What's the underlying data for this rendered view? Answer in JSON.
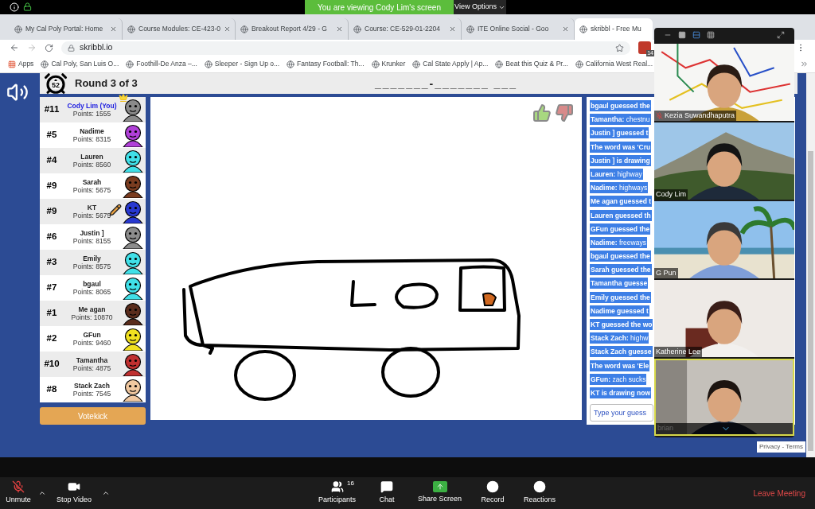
{
  "share_bar": {
    "message": "You are viewing Cody Lim's screen",
    "options": "View Options"
  },
  "tabs": [
    {
      "title": "My Cal Poly Portal: Home",
      "selected": false
    },
    {
      "title": "Course Modules: CE-423-0",
      "selected": false
    },
    {
      "title": "Breakout Report 4/29 - G",
      "selected": false
    },
    {
      "title": "Course: CE-529-01-2204",
      "selected": false
    },
    {
      "title": "ITE Online Social - Goo",
      "selected": false
    },
    {
      "title": "skribbl - Free Mu",
      "selected": true
    }
  ],
  "address": {
    "url": "skribbl.io",
    "extension_badge": "14"
  },
  "bookmarks": [
    "Apps",
    "Cal Poly, San Luis O...",
    "Foothill-De Anza –...",
    "Sleeper - Sign Up o...",
    "Fantasy Football: Th...",
    "Krunker",
    "Cal State Apply | Ap...",
    "Beat this Quiz & Pr...",
    "California West Real..."
  ],
  "game": {
    "timer": "52",
    "round": "Round 3 of 3",
    "hint": "_______-_______ ___",
    "players": [
      {
        "rank": "#11",
        "name": "Cody Lim (You)",
        "points": "Points: 1555",
        "you": true,
        "owner": true,
        "drawing": false,
        "color": "#8a8a8a"
      },
      {
        "rank": "#5",
        "name": "Nadime",
        "points": "Points: 8315",
        "you": false,
        "owner": false,
        "drawing": false,
        "color": "#b040d8"
      },
      {
        "rank": "#4",
        "name": "Lauren",
        "points": "Points: 8560",
        "you": false,
        "owner": false,
        "drawing": false,
        "color": "#40e0e8"
      },
      {
        "rank": "#9",
        "name": "Sarah",
        "points": "Points: 5675",
        "you": false,
        "owner": false,
        "drawing": false,
        "color": "#7a3c20"
      },
      {
        "rank": "#9",
        "name": "KT",
        "points": "Points: 5675",
        "you": false,
        "owner": false,
        "drawing": true,
        "color": "#2838d0"
      },
      {
        "rank": "#6",
        "name": "Justin ]",
        "points": "Points: 8155",
        "you": false,
        "owner": false,
        "drawing": false,
        "color": "#8c8c8c"
      },
      {
        "rank": "#3",
        "name": "Emily",
        "points": "Points: 8575",
        "you": false,
        "owner": false,
        "drawing": false,
        "color": "#40e0e8"
      },
      {
        "rank": "#7",
        "name": "bgaul",
        "points": "Points: 8065",
        "you": false,
        "owner": false,
        "drawing": false,
        "color": "#40e0e8"
      },
      {
        "rank": "#1",
        "name": "Me agan",
        "points": "Points: 10870",
        "you": false,
        "owner": false,
        "drawing": false,
        "color": "#5a2c1c"
      },
      {
        "rank": "#2",
        "name": "GFun",
        "points": "Points: 9460",
        "you": false,
        "owner": false,
        "drawing": false,
        "color": "#f0e020"
      },
      {
        "rank": "#10",
        "name": "Tamantha",
        "points": "Points: 4875",
        "you": false,
        "owner": false,
        "drawing": false,
        "color": "#c03030"
      },
      {
        "rank": "#8",
        "name": "Stack Zach",
        "points": "Points: 7545",
        "you": false,
        "owner": false,
        "drawing": false,
        "color": "#f0c8a0"
      }
    ],
    "votekick": "Votekick",
    "chat": [
      {
        "kind": "system",
        "text": "bgaul guessed the"
      },
      {
        "kind": "chat",
        "text": "**Tamantha:** chestnu"
      },
      {
        "kind": "system",
        "text": "Justin ] guessed t"
      },
      {
        "kind": "system",
        "text": "The word was 'Cru"
      },
      {
        "kind": "system",
        "text": "Justin ] is drawing"
      },
      {
        "kind": "chat",
        "text": "**Lauren:** highway"
      },
      {
        "kind": "chat",
        "text": "**Nadime:** highways"
      },
      {
        "kind": "system",
        "text": "Me agan guessed t"
      },
      {
        "kind": "system",
        "text": "Lauren guessed th"
      },
      {
        "kind": "system",
        "text": "GFun guessed the"
      },
      {
        "kind": "chat",
        "text": "**Nadime:** freeways"
      },
      {
        "kind": "system",
        "text": "bgaul guessed the"
      },
      {
        "kind": "system",
        "text": "Sarah guessed the"
      },
      {
        "kind": "system",
        "text": "Tamantha guesse"
      },
      {
        "kind": "system",
        "text": "Emily guessed the"
      },
      {
        "kind": "system",
        "text": "Nadime guessed t"
      },
      {
        "kind": "system",
        "text": "KT guessed the wo"
      },
      {
        "kind": "chat",
        "text": "**Stack Zach:** highw"
      },
      {
        "kind": "system",
        "text": "Stack Zach guesse"
      },
      {
        "kind": "system",
        "text": "The word was 'Ele"
      },
      {
        "kind": "chat",
        "text": "**GFun:** zach sucks"
      },
      {
        "kind": "system",
        "text": "KT is drawing now"
      }
    ],
    "guess_placeholder": "Type your guess",
    "recaptcha": "Privacy - Terms"
  },
  "videos": [
    {
      "name": "Kezia Suwandhaputra",
      "muted": true,
      "speaking": false
    },
    {
      "name": "Cody Lim",
      "muted": false,
      "speaking": false
    },
    {
      "name": "G Pun",
      "muted": false,
      "speaking": false
    },
    {
      "name": "Katherine Lee",
      "muted": false,
      "speaking": false
    },
    {
      "name": "brian",
      "muted": false,
      "speaking": true
    }
  ],
  "toolbar": {
    "left": [
      "Unmute",
      "Stop Video"
    ],
    "center": [
      "Participants",
      "Chat",
      "Share Screen",
      "Record",
      "Reactions"
    ],
    "participant_count": "16",
    "leave": "Leave Meeting"
  }
}
